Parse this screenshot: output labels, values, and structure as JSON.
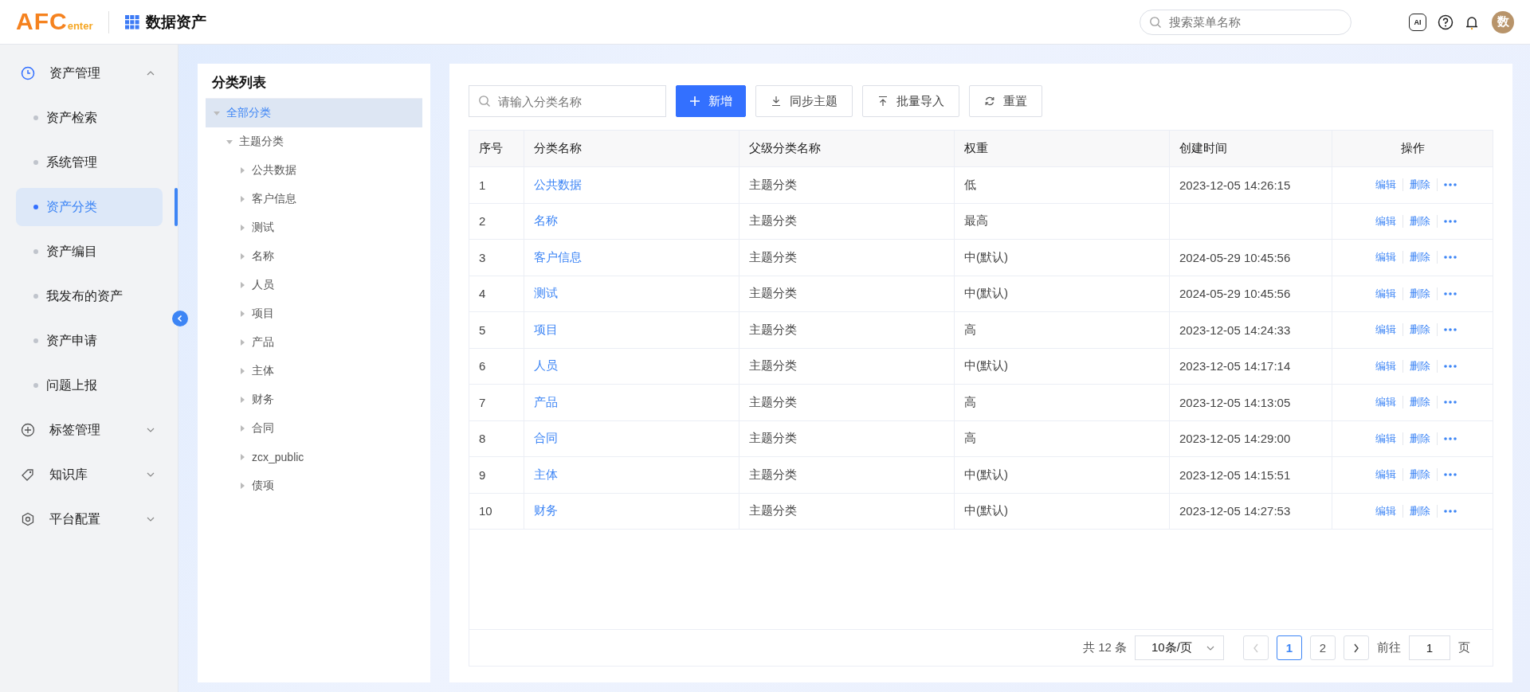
{
  "header": {
    "logo": {
      "main": "AFC",
      "sub": "enter"
    },
    "app_title": "数据资产",
    "search": {
      "placeholder": "搜索菜单名称"
    },
    "ai_badge": "AI",
    "avatar": "数"
  },
  "sidebar": {
    "items": [
      {
        "label": "资产管理",
        "expanded": true,
        "children": [
          {
            "label": "资产检索",
            "selected": false
          },
          {
            "label": "系统管理",
            "selected": false
          },
          {
            "label": "资产分类",
            "selected": true
          },
          {
            "label": "资产编目",
            "selected": false
          },
          {
            "label": "我发布的资产",
            "selected": false
          },
          {
            "label": "资产申请",
            "selected": false
          },
          {
            "label": "问题上报",
            "selected": false
          }
        ]
      },
      {
        "label": "标签管理",
        "expanded": false
      },
      {
        "label": "知识库",
        "expanded": false
      },
      {
        "label": "平台配置",
        "expanded": false
      }
    ]
  },
  "tree_panel": {
    "title": "分类列表",
    "tree": [
      {
        "label": "全部分类",
        "selected": true,
        "expanded": true,
        "children": [
          {
            "label": "主题分类",
            "selected": false,
            "expanded": true,
            "children": [
              {
                "label": "公共数据",
                "selected": false,
                "expanded": false
              },
              {
                "label": "客户信息",
                "selected": false,
                "expanded": false
              },
              {
                "label": "测试",
                "selected": false,
                "expanded": false
              },
              {
                "label": "名称",
                "selected": false,
                "expanded": false
              },
              {
                "label": "人员",
                "selected": false,
                "expanded": false
              },
              {
                "label": "项目",
                "selected": false,
                "expanded": false
              },
              {
                "label": "产品",
                "selected": false,
                "expanded": false
              },
              {
                "label": "主体",
                "selected": false,
                "expanded": false
              },
              {
                "label": "财务",
                "selected": false,
                "expanded": false
              },
              {
                "label": "合同",
                "selected": false,
                "expanded": false
              },
              {
                "label": "zcx_public",
                "selected": false,
                "expanded": false
              },
              {
                "label": "债项",
                "selected": false,
                "expanded": false
              }
            ]
          }
        ]
      }
    ]
  },
  "toolbar": {
    "search": {
      "placeholder": "请输入分类名称"
    },
    "buttons": [
      {
        "label": "新增",
        "kind": "add"
      },
      {
        "label": "同步主题",
        "kind": "download"
      },
      {
        "label": "批量导入",
        "kind": "upload"
      },
      {
        "label": "重置",
        "kind": "reset"
      }
    ]
  },
  "table": {
    "columns": [
      "序号",
      "分类名称",
      "父级分类名称",
      "权重",
      "创建时间",
      "操作"
    ],
    "rows": [
      {
        "index": "1",
        "name": "公共数据",
        "parent": "主题分类",
        "weight": "低",
        "created": "2023-12-05 14:26:15",
        "actions": [
          "编辑",
          "删除"
        ]
      },
      {
        "index": "2",
        "name": "名称",
        "parent": "主题分类",
        "weight": "最高",
        "actions": [
          "编辑",
          "删除"
        ]
      },
      {
        "index": "3",
        "name": "客户信息",
        "parent": "主题分类",
        "weight": "中(默认)",
        "created": "2024-05-29 10:45:56",
        "actions": [
          "编辑",
          "删除"
        ]
      },
      {
        "index": "4",
        "name": "测试",
        "parent": "主题分类",
        "weight": "中(默认)",
        "created": "2024-05-29 10:45:56",
        "actions": [
          "编辑",
          "删除"
        ]
      },
      {
        "index": "5",
        "name": "项目",
        "parent": "主题分类",
        "weight": "高",
        "created": "2023-12-05 14:24:33",
        "actions": [
          "编辑",
          "删除"
        ]
      },
      {
        "index": "6",
        "name": "人员",
        "parent": "主题分类",
        "weight": "中(默认)",
        "created": "2023-12-05 14:17:14",
        "actions": [
          "编辑",
          "删除"
        ]
      },
      {
        "index": "7",
        "name": "产品",
        "parent": "主题分类",
        "weight": "高",
        "created": "2023-12-05 14:13:05",
        "actions": [
          "编辑",
          "删除"
        ]
      },
      {
        "index": "8",
        "name": "合同",
        "parent": "主题分类",
        "weight": "高",
        "created": "2023-12-05 14:29:00",
        "actions": [
          "编辑",
          "删除"
        ]
      },
      {
        "index": "9",
        "name": "主体",
        "parent": "主题分类",
        "weight": "中(默认)",
        "created": "2023-12-05 14:15:51",
        "actions": [
          "编辑",
          "删除"
        ]
      },
      {
        "index": "10",
        "name": "财务",
        "parent": "主题分类",
        "weight": "中(默认)",
        "created": "2023-12-05 14:27:53",
        "actions": [
          "编辑",
          "删除"
        ]
      }
    ]
  },
  "pagination": {
    "total": "共 12 条",
    "page_size": "10条/页",
    "prev_disabled": true,
    "next_disabled": false,
    "pages": [
      {
        "label": "1",
        "selected": true
      },
      {
        "label": "2",
        "selected": false
      }
    ],
    "goto_label": "前往",
    "goto_value": "1",
    "goto_suffix": "页"
  }
}
